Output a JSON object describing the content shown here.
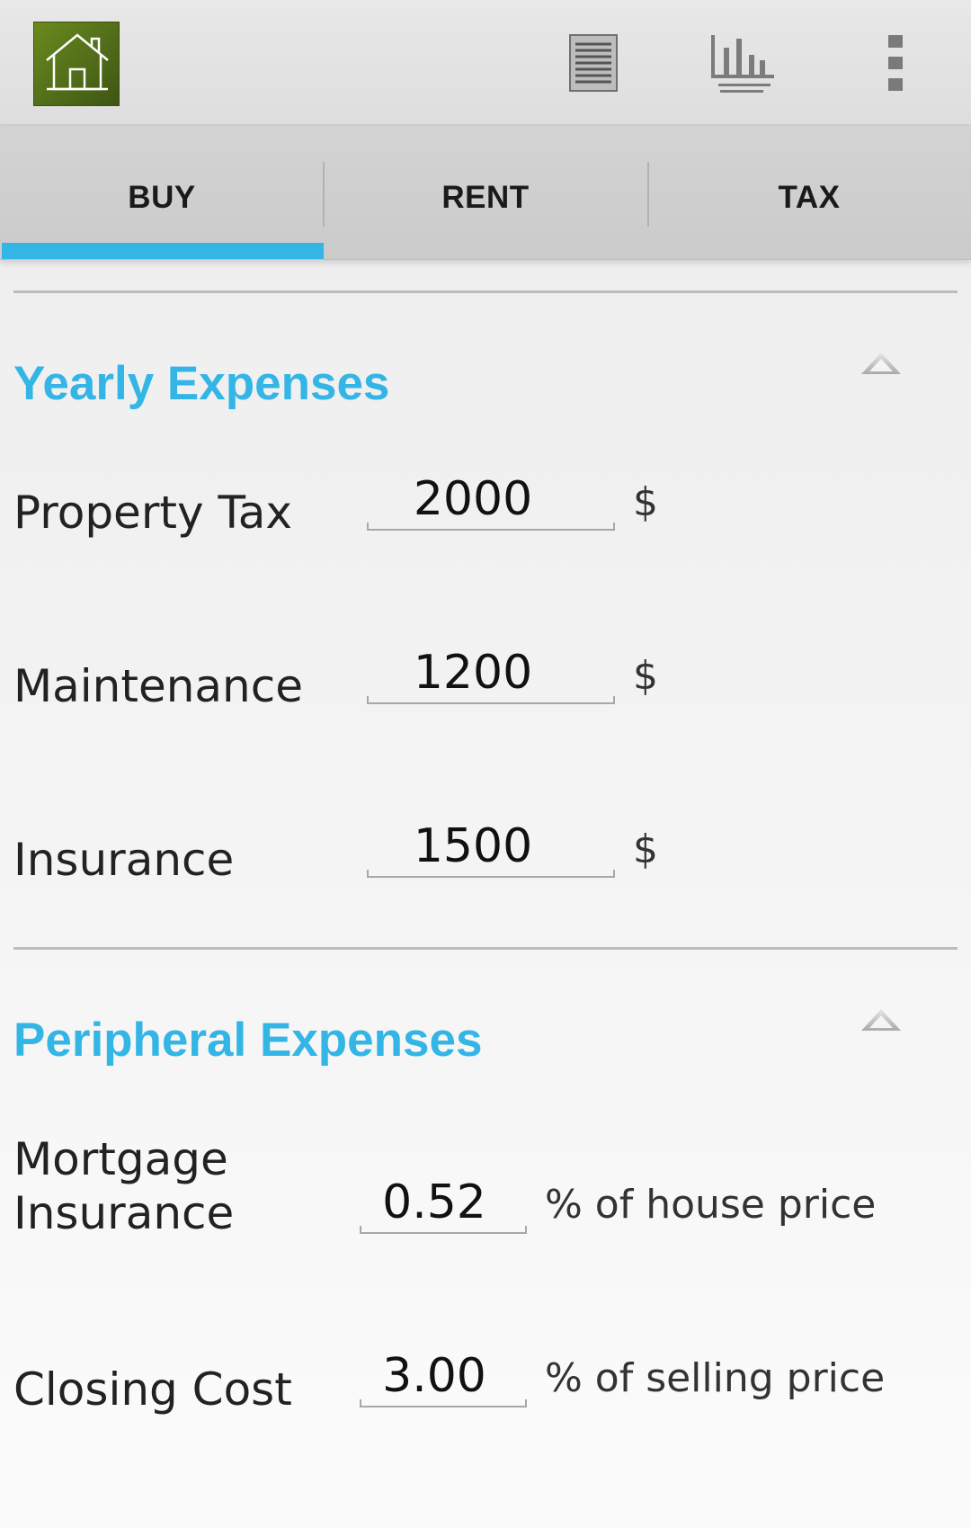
{
  "action_bar": {
    "app_icon": "house-icon",
    "actions": [
      {
        "icon": "list-icon"
      },
      {
        "icon": "bar-chart-icon"
      },
      {
        "icon": "overflow-menu-icon"
      }
    ]
  },
  "tabs": [
    {
      "label": "BUY",
      "selected": true
    },
    {
      "label": "RENT",
      "selected": false
    },
    {
      "label": "TAX",
      "selected": false
    }
  ],
  "yearly": {
    "title": "Yearly Expenses",
    "rows": [
      {
        "label": "Property Tax",
        "value": "2000",
        "unit": "$"
      },
      {
        "label": "Maintenance",
        "value": "1200",
        "unit": "$"
      },
      {
        "label": "Insurance",
        "value": "1500",
        "unit": "$"
      }
    ]
  },
  "peripheral": {
    "title": "Peripheral Expenses",
    "rows": [
      {
        "label_line1": "Mortgage",
        "label_line2": "Insurance",
        "value": "0.52",
        "unit": "% of house price"
      },
      {
        "label": "Closing Cost",
        "value": "3.00",
        "unit": "% of selling price"
      }
    ]
  },
  "colors": {
    "accent": "#33b5e5",
    "app_icon_green": "#5a7a1a"
  }
}
